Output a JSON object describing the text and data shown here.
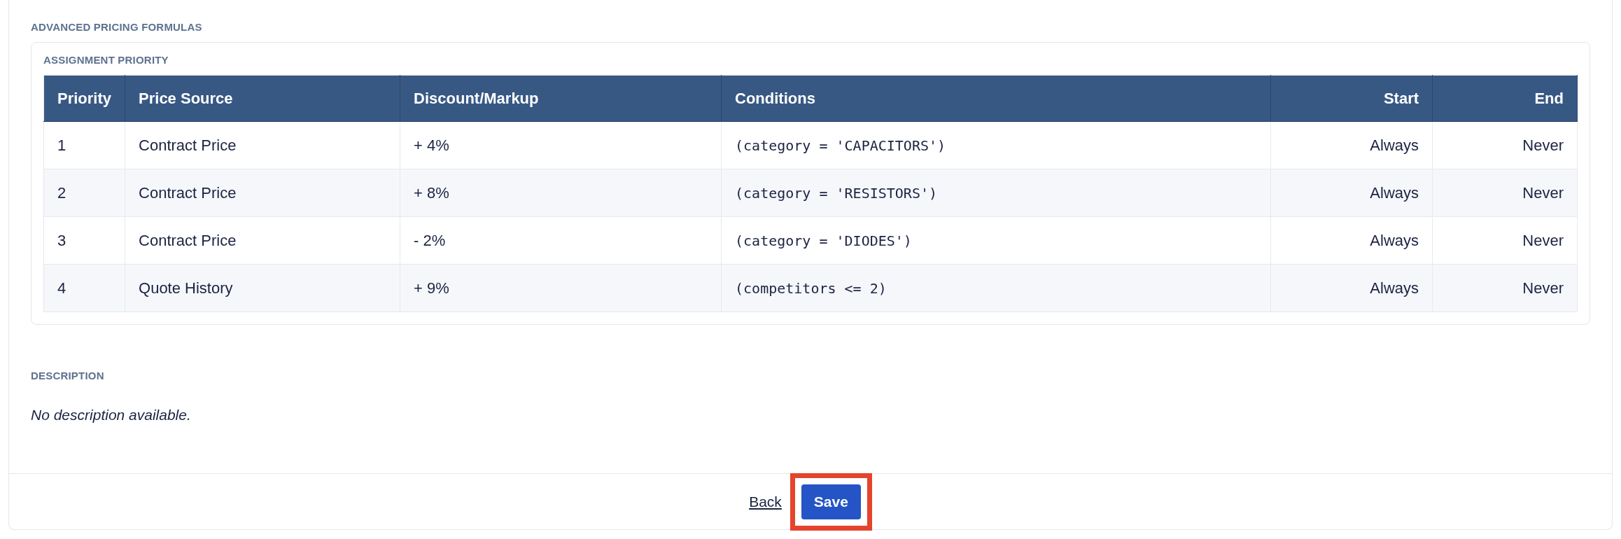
{
  "formulas_section": {
    "title": "ADVANCED PRICING FORMULAS",
    "subtitle": "ASSIGNMENT PRIORITY",
    "table": {
      "columns": [
        "Priority",
        "Price Source",
        "Discount/Markup",
        "Conditions",
        "Start",
        "End"
      ],
      "rows": [
        [
          "1",
          "Contract Price",
          "+ 4%",
          "(category = 'CAPACITORS')",
          "Always",
          "Never"
        ],
        [
          "2",
          "Contract Price",
          "+ 8%",
          "(category = 'RESISTORS')",
          "Always",
          "Never"
        ],
        [
          "3",
          "Contract Price",
          "- 2%",
          "(category = 'DIODES')",
          "Always",
          "Never"
        ],
        [
          "4",
          "Quote History",
          "+ 9%",
          "(competitors <= 2)",
          "Always",
          "Never"
        ]
      ]
    }
  },
  "description": {
    "title": "DESCRIPTION",
    "text": "No description available."
  },
  "footer": {
    "back_link": "Back",
    "save_button": {
      "label": "Save",
      "highlighted": true
    }
  }
}
